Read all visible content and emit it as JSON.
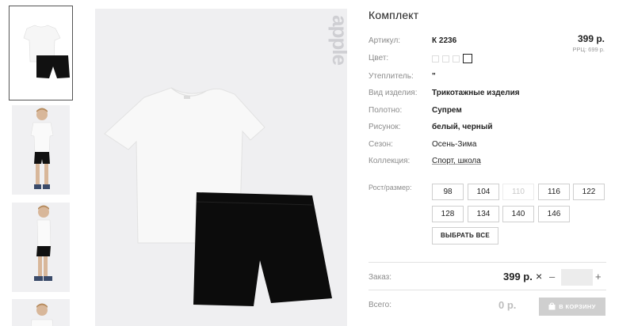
{
  "product": {
    "title": "Комплект",
    "price": "399 р.",
    "rrp": "РРЦ: 699 р.",
    "attributes": [
      {
        "label": "Артикул:",
        "value": "К 2236"
      },
      {
        "label": "Цвет:",
        "value": ""
      },
      {
        "label": "Утеплитель:",
        "value": "\""
      },
      {
        "label": "Вид изделия:",
        "value": "Трикотажные изделия"
      },
      {
        "label": "Полотно:",
        "value": "Супрем"
      },
      {
        "label": "Рисунок:",
        "value": "белый, черный"
      },
      {
        "label": "Сезон:",
        "value": "Осень-Зима"
      },
      {
        "label": "Коллекция:",
        "value": "Спорт, школа"
      }
    ],
    "color_swatches": [
      "#ffffff",
      "#ffffff",
      "#ffffff",
      "#ffffff"
    ],
    "selected_swatch": 3,
    "brand_watermark": "apple"
  },
  "sizes": {
    "label": "Рост/размер:",
    "options": [
      {
        "value": "98",
        "available": true
      },
      {
        "value": "104",
        "available": true
      },
      {
        "value": "110",
        "available": false
      },
      {
        "value": "116",
        "available": true
      },
      {
        "value": "122",
        "available": true
      },
      {
        "value": "128",
        "available": true
      },
      {
        "value": "134",
        "available": true
      },
      {
        "value": "140",
        "available": true
      },
      {
        "value": "146",
        "available": true
      }
    ],
    "select_all_label": "ВЫБРАТЬ ВСЕ"
  },
  "order": {
    "label": "Заказ:",
    "price": "399 р.",
    "times_symbol": "×",
    "minus": "–",
    "plus": "+",
    "quantity": ""
  },
  "total": {
    "label": "Всего:",
    "value": "0 р.",
    "cart_button": "В КОРЗИНУ"
  },
  "colors": {
    "border_selected": "#555555",
    "cart_button_bg": "#cfcfcf",
    "image_bg": "#efeff1"
  }
}
